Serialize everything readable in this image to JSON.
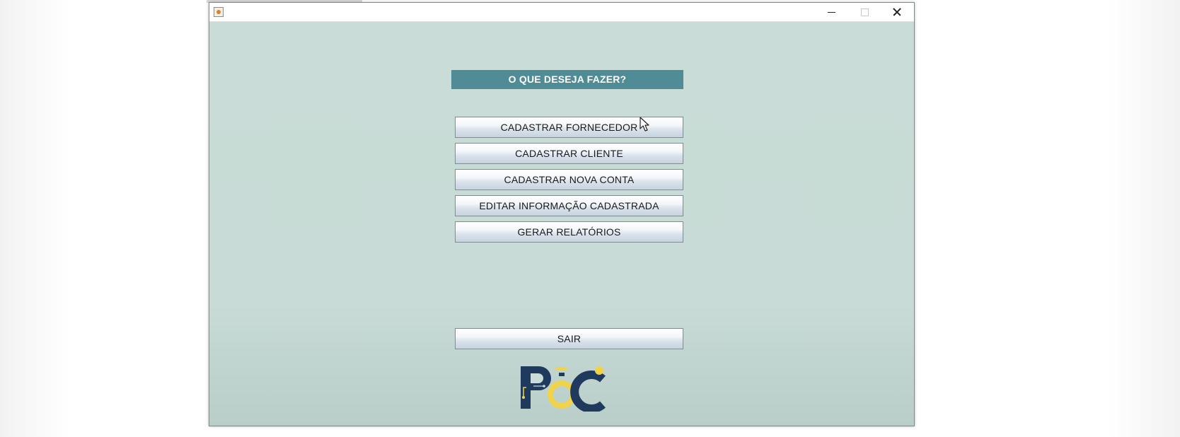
{
  "window": {
    "title_icon": "java-app-icon",
    "controls": [
      "minimize-icon",
      "maximize-icon",
      "close-icon"
    ]
  },
  "main": {
    "header": "O QUE DESEJA FAZER?",
    "buttons": [
      "CADASTRAR FORNECEDOR",
      "CADASTRAR CLIENTE",
      "CADASTRAR NOVA CONTA",
      "EDITAR INFORMAÇÃO CADASTRADA",
      "GERAR RELATÓRIOS"
    ],
    "exit_label": "SAIR"
  },
  "logo": {
    "text": "POC",
    "colors": {
      "navy": "#1f3a5c",
      "yellow": "#f1d34a"
    }
  },
  "colors": {
    "background": "#c9dcd7",
    "header_bg": "#4f8c96",
    "header_text": "#ffffff"
  }
}
